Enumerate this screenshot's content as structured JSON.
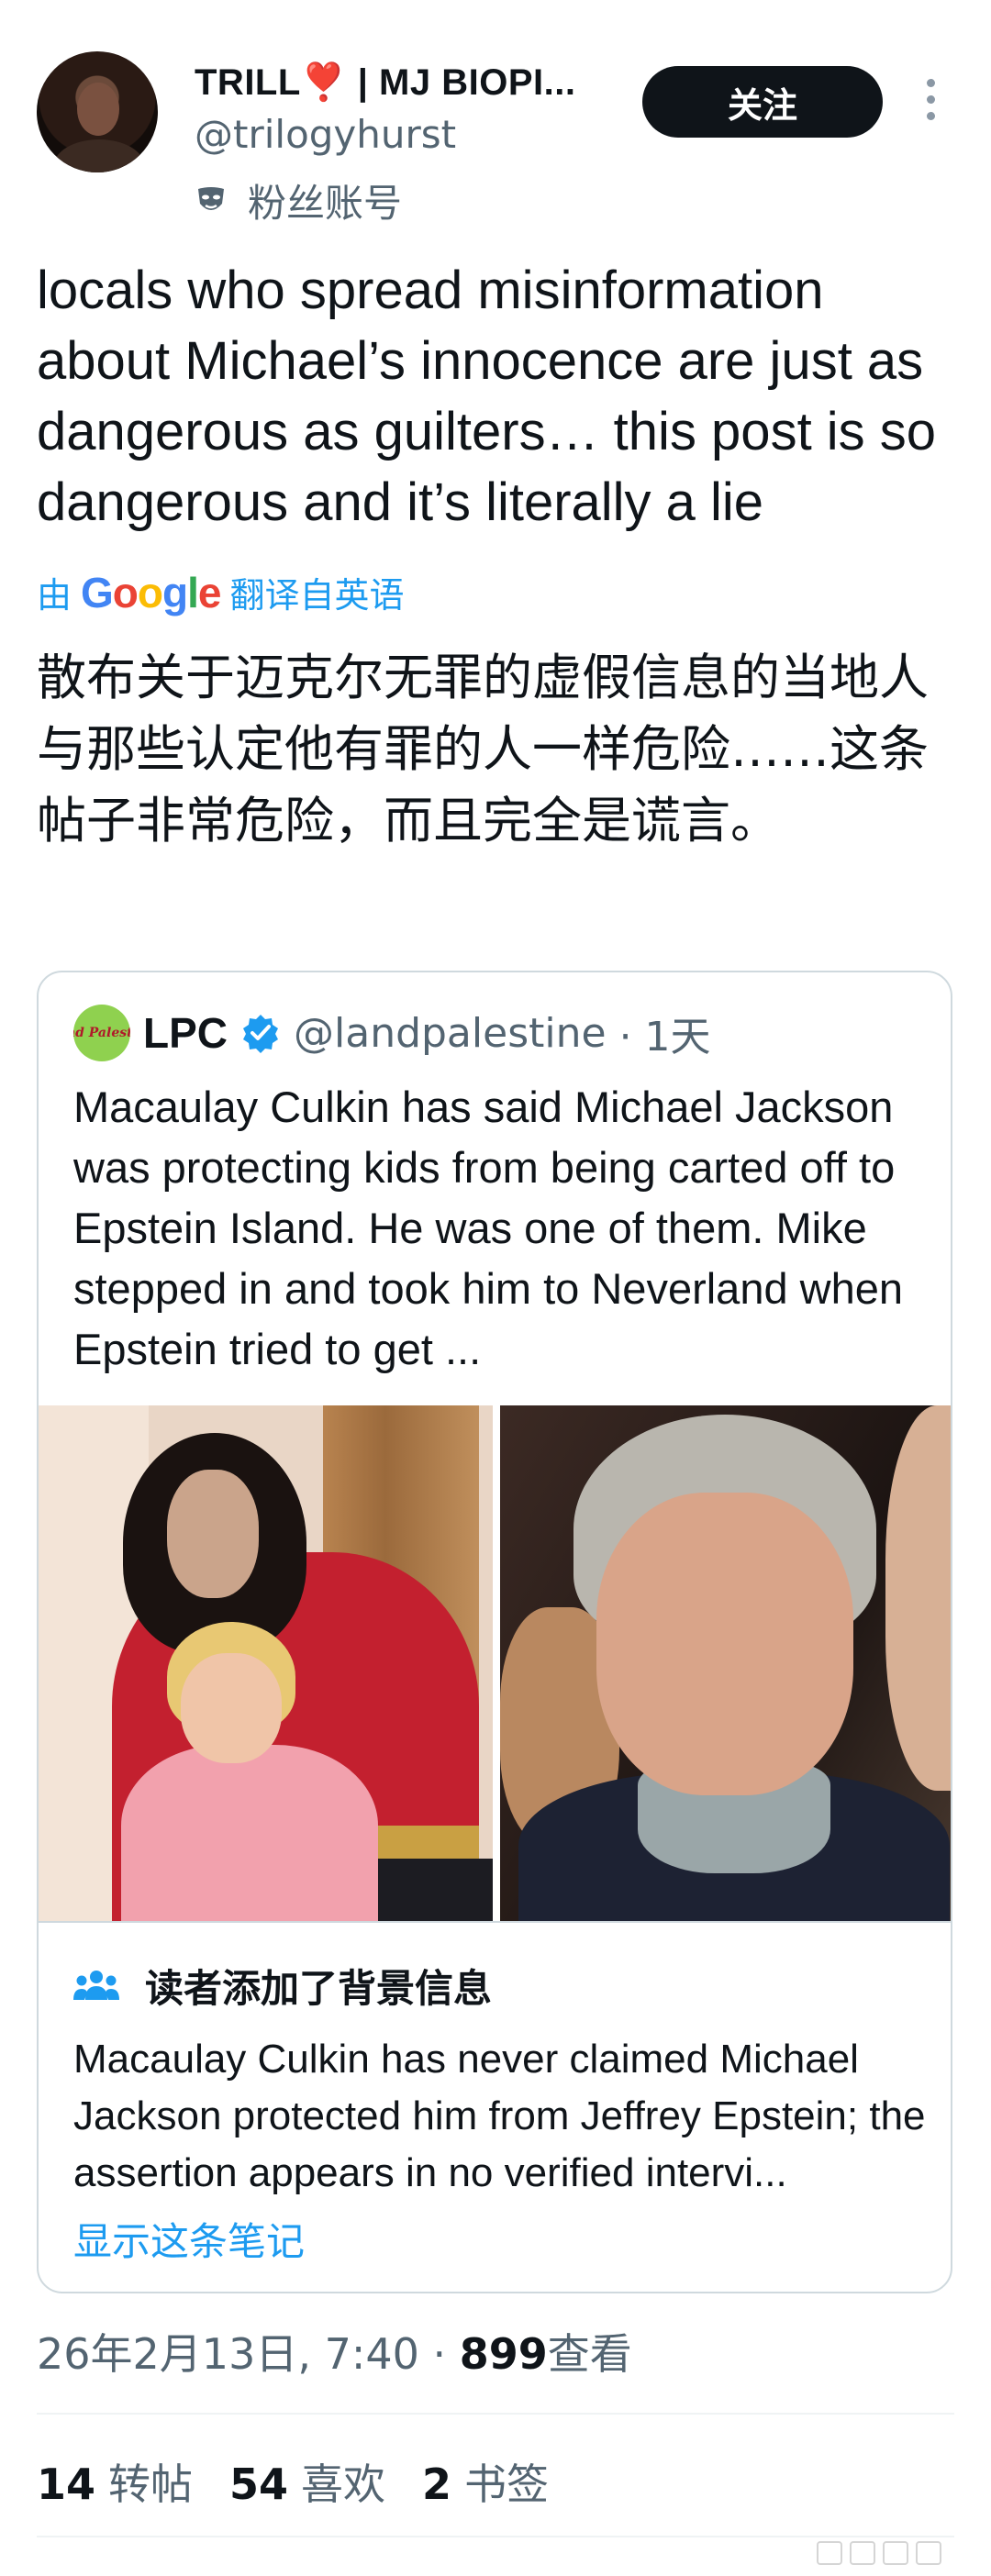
{
  "author": {
    "display_name": "TRILL❣️ | MJ BIOPI...",
    "handle": "@trilogyhurst",
    "fan_label": "粉丝账号"
  },
  "follow_label": "关注",
  "tweet": {
    "text": "locals who spread misinformation about Michael’s innocence are just as dangerous as guilters… this post is so dangerous and it’s literally a lie",
    "translate_prefix": "由",
    "translate_suffix": "翻译自英语",
    "translated_text": "散布关于迈克尔无罪的虚假信息的当地人与那些认定他有罪的人一样危险……这条帖子非常危险，而且完全是谎言。"
  },
  "google_letters": [
    "G",
    "o",
    "o",
    "g",
    "l",
    "e"
  ],
  "quote": {
    "avatar_text": "Land Palestine",
    "name": "LPC",
    "handle": "@landpalestine",
    "time": "· 1天",
    "text": "Macaulay Culkin has said Michael Jackson was protecting kids from being carted off to Epstein Island. He was one of them. Mike stepped in and took him to Neverland when Epstein tried to get ..."
  },
  "community_note": {
    "title": "读者添加了背景信息",
    "text": "Macaulay Culkin has never claimed Michael Jackson protected him from Jeffrey Epstein; the assertion appears in no verified intervi...",
    "link": "显示这条笔记"
  },
  "meta": {
    "timestamp": "26年2月13日, 7:40 · ",
    "views": "899",
    "views_label": "查看"
  },
  "stats": {
    "reposts": "14",
    "reposts_label": "转帖",
    "likes": "54",
    "likes_label": "喜欢",
    "bookmarks": "2",
    "bookmarks_label": "书签"
  },
  "colors": {
    "link": "#1d9bf0",
    "button_bg": "#0f1419",
    "secondary_text": "#536471",
    "border": "#cfd9de"
  },
  "icons": [
    "mask-icon",
    "more-icon",
    "verified-icon",
    "people-icon"
  ]
}
